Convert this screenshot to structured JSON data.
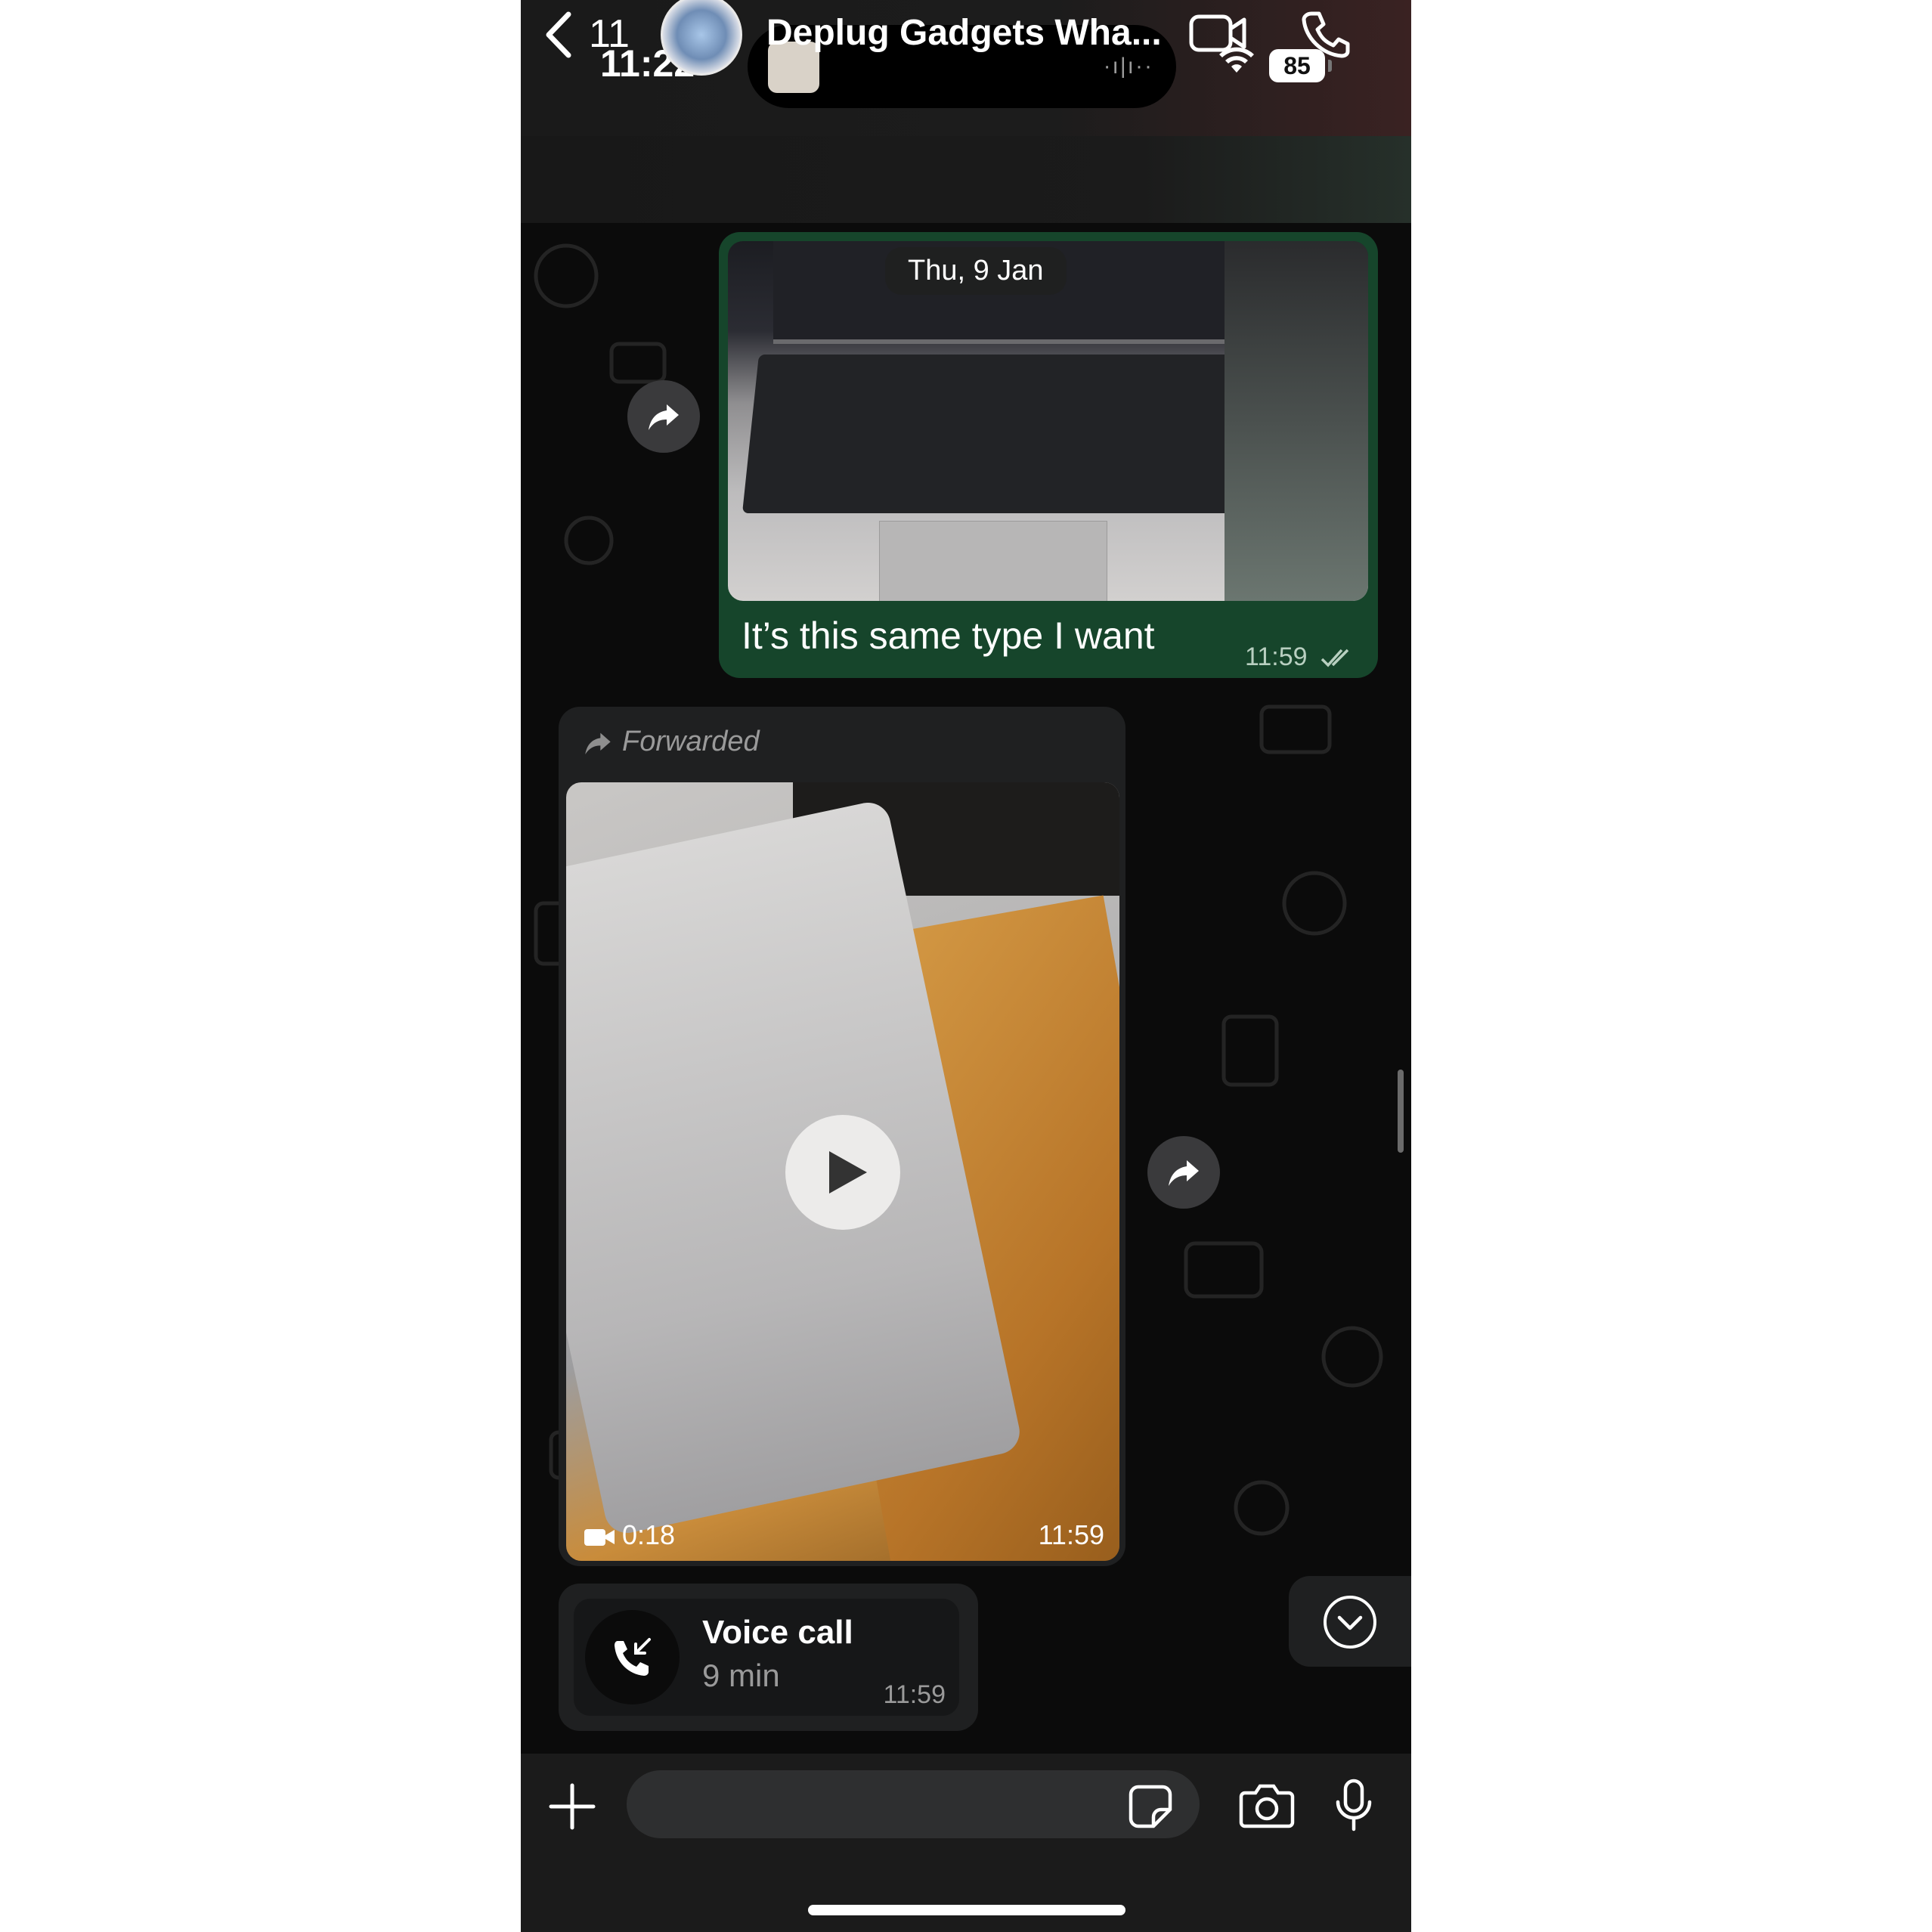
{
  "status_bar": {
    "time": "11:22",
    "battery": "85",
    "island_wave": "·ı|ı··"
  },
  "header": {
    "back_count": "11",
    "chat_title": "Deplug Gadgets Wha...",
    "icons": [
      "chevron-left-icon",
      "group-avatar",
      "video-call-icon",
      "phone-icon"
    ]
  },
  "messages": {
    "outgoing": {
      "date_chip": "Thu, 9 Jan",
      "caption": "It’s this same type I want",
      "time": "11:59",
      "status": "read"
    },
    "incoming_video": {
      "forwarded_label": "Forwarded",
      "duration": "0:18",
      "time": "11:59"
    },
    "call": {
      "title": "Voice call",
      "duration": "9 min",
      "time": "11:59"
    }
  },
  "composer": {
    "placeholder": "",
    "icons": [
      "plus-icon",
      "sticker-icon",
      "camera-icon",
      "microphone-icon"
    ]
  },
  "colors": {
    "outgoing_bubble": "#16452b",
    "incoming_bubble": "#1f2021",
    "background": "#0b0b0b"
  }
}
